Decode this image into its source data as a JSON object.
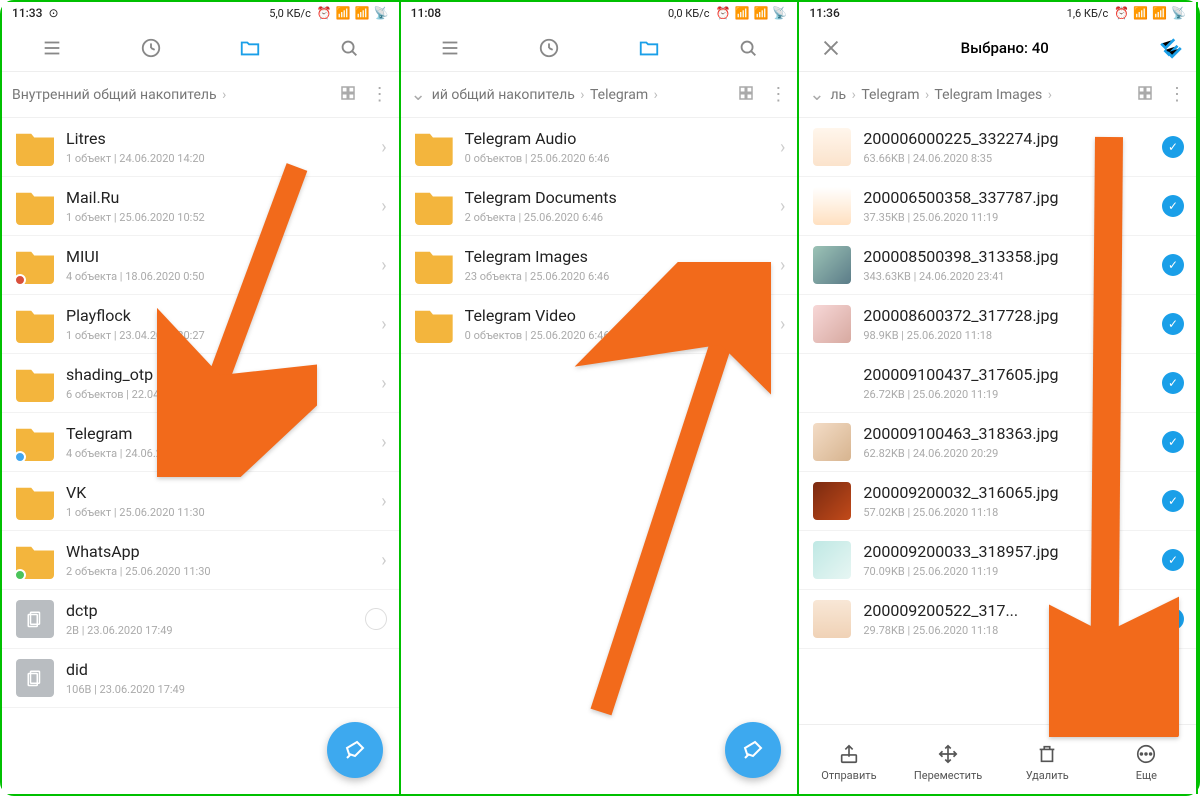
{
  "screens": [
    {
      "status": {
        "time": "11:33",
        "net": "5,0 КБ/с"
      },
      "breadcrumb": [
        "Внутренний общий накопитель"
      ],
      "rows": [
        {
          "kind": "folder",
          "name": "Litres",
          "sub": "1 объект  |  24.06.2020 14:20"
        },
        {
          "kind": "folder",
          "name": "Mail.Ru",
          "sub": "1 объект  |  25.06.2020 10:52"
        },
        {
          "kind": "folder",
          "name": "MIUI",
          "sub": "4 объекта  |  18.06.2020 0:50",
          "badge": "#d94f3b"
        },
        {
          "kind": "folder",
          "name": "Playflock",
          "sub": "1 объект  |  23.04.2020 20:27"
        },
        {
          "kind": "folder",
          "name": "shading_otp",
          "sub": "6 объектов  |  22.04.2020 14:09"
        },
        {
          "kind": "folder",
          "name": "Telegram",
          "sub": "4 объекта  |  24.06.2020 6:50",
          "badge": "#42a6ef"
        },
        {
          "kind": "folder",
          "name": "VK",
          "sub": "1 объект  |  25.06.2020 11:30"
        },
        {
          "kind": "folder",
          "name": "WhatsApp",
          "sub": "2 объекта  |  25.06.2020 11:30",
          "badge": "#4bc35a"
        },
        {
          "kind": "file",
          "name": "dctp",
          "sub": "2B  |  23.06.2020 17:49",
          "circle": true
        },
        {
          "kind": "file",
          "name": "did",
          "sub": "106B  |  23.06.2020 17:49"
        }
      ],
      "fab": true
    },
    {
      "status": {
        "time": "11:08",
        "net": "0,0 КБ/с"
      },
      "breadcrumb": [
        "ий общий накопитель",
        "Telegram"
      ],
      "backchev": true,
      "rows": [
        {
          "kind": "folder",
          "name": "Telegram Audio",
          "sub": "0 объектов  |  25.06.2020 6:46"
        },
        {
          "kind": "folder",
          "name": "Telegram Documents",
          "sub": "2 объекта  |  25.06.2020 6:46"
        },
        {
          "kind": "folder",
          "name": "Telegram Images",
          "sub": "23 объекта  |  25.06.2020 6:46"
        },
        {
          "kind": "folder",
          "name": "Telegram Video",
          "sub": "0 объектов  |  25.06.2020 6:46"
        }
      ],
      "fab": true
    },
    {
      "status": {
        "time": "11:36",
        "net": "1,6 КБ/с"
      },
      "selection_title": "Выбрано: 40",
      "breadcrumb": [
        "ль",
        "Telegram",
        "Telegram Images"
      ],
      "backchev": true,
      "rows": [
        {
          "kind": "img",
          "name": "200006000225_332274.jpg",
          "sub": "63.66KB  |  24.06.2020 8:35",
          "checked": true,
          "thumb": "linear-gradient(180deg,#fff6ec,#fbe3cc)"
        },
        {
          "kind": "img",
          "name": "200006500358_337787.jpg",
          "sub": "37.35KB  |  25.06.2020 11:19",
          "checked": true,
          "thumb": "linear-gradient(180deg,#fff,#ffe0c0)"
        },
        {
          "kind": "img",
          "name": "200008500398_313358.jpg",
          "sub": "343.63KB  |  24.06.2020 23:41",
          "checked": true,
          "thumb": "linear-gradient(135deg,#9cc3b6,#5b7c88)"
        },
        {
          "kind": "img",
          "name": "200008600372_317728.jpg",
          "sub": "98.9KB  |  25.06.2020 11:18",
          "checked": true,
          "thumb": "linear-gradient(135deg,#f7d7d7,#d7a9a0)"
        },
        {
          "kind": "img",
          "name": "200009100437_317605.jpg",
          "sub": "26.72KB  |  25.06.2020 11:19",
          "checked": true,
          "thumb": "linear-gradient(180deg,#fff,#fff)"
        },
        {
          "kind": "img",
          "name": "200009100463_318363.jpg",
          "sub": "62.82KB  |  24.06.2020 20:29",
          "checked": true,
          "thumb": "linear-gradient(135deg,#f3dcc6,#d7b48f)"
        },
        {
          "kind": "img",
          "name": "200009200032_316065.jpg",
          "sub": "57.02KB  |  25.06.2020 11:18",
          "checked": true,
          "thumb": "linear-gradient(135deg,#7a2a10,#c24a1a)"
        },
        {
          "kind": "img",
          "name": "200009200033_318957.jpg",
          "sub": "70.09KB  |  25.06.2020 11:19",
          "checked": true,
          "thumb": "linear-gradient(135deg,#bfe8e4,#e7f6f3)"
        },
        {
          "kind": "img",
          "name": "200009200522_317...",
          "sub": "29.78KB  |  25.06.2020 11:18",
          "checked": true,
          "thumb": "linear-gradient(180deg,#f8e7d6,#f0d2b6)"
        }
      ],
      "actions": [
        {
          "label": "Отправить",
          "icon": "share"
        },
        {
          "label": "Переместить",
          "icon": "move"
        },
        {
          "label": "Удалить",
          "icon": "trash"
        },
        {
          "label": "Еще",
          "icon": "more"
        }
      ]
    }
  ]
}
